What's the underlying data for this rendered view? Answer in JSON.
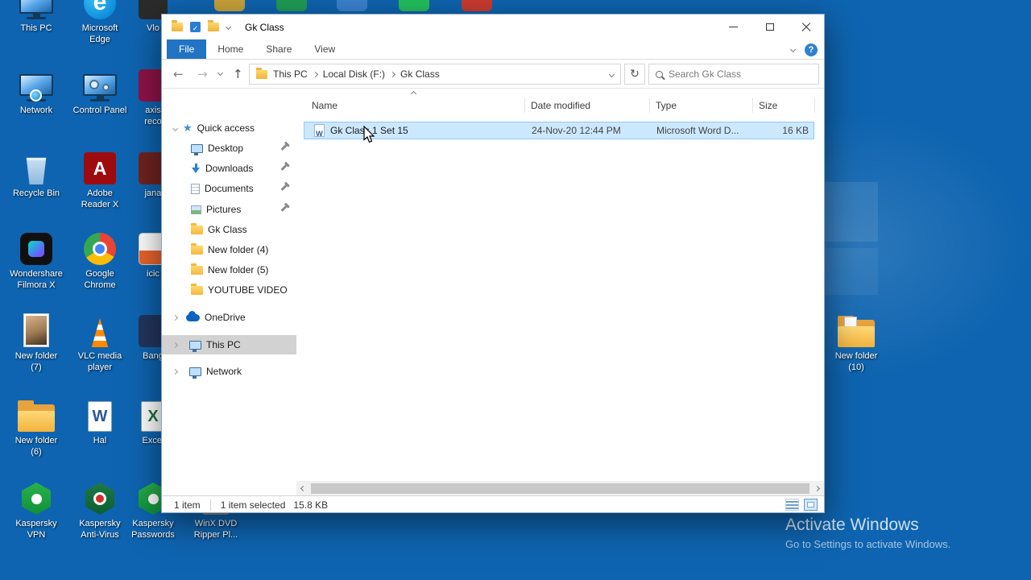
{
  "desktop": {
    "bg_color": "#0e64b0",
    "activate": {
      "line1": "Activate Windows",
      "line2": "Go to Settings to activate Windows."
    },
    "icons": [
      {
        "label": "This PC"
      },
      {
        "label": "Network"
      },
      {
        "label": "Recycle Bin"
      },
      {
        "label": "Wondershare Filmora X"
      },
      {
        "label": "New folder (7)"
      },
      {
        "label": "New folder (6)"
      },
      {
        "label": "Kaspersky VPN"
      },
      {
        "label": "Microsoft Edge"
      },
      {
        "label": "Control Panel"
      },
      {
        "label": "Adobe Reader X"
      },
      {
        "label": "Google Chrome"
      },
      {
        "label": "VLC media player"
      },
      {
        "label": "Hal"
      },
      {
        "label": "Kaspersky Anti-Virus"
      },
      {
        "label": "Vlo"
      },
      {
        "label": "axis reco"
      },
      {
        "label": "jana"
      },
      {
        "label": "icic"
      },
      {
        "label": "Bang"
      },
      {
        "label": "Excel"
      },
      {
        "label": "Kaspersky Passwords"
      },
      {
        "label": "WinX DVD Ripper Pl..."
      },
      {
        "label": "New folder (10)"
      }
    ]
  },
  "explorer": {
    "title": "Gk Class",
    "ribbon": {
      "file": "File",
      "home": "Home",
      "share": "Share",
      "view": "View"
    },
    "address": {
      "crumbs": [
        "This PC",
        "Local Disk (F:)",
        "Gk Class"
      ]
    },
    "search_placeholder": "Search Gk Class",
    "sidebar": {
      "quick_access_label": "Quick access",
      "pinned": [
        {
          "label": "Desktop"
        },
        {
          "label": "Downloads"
        },
        {
          "label": "Documents"
        },
        {
          "label": "Pictures"
        }
      ],
      "folders": [
        {
          "label": "Gk Class"
        },
        {
          "label": "New folder (4)"
        },
        {
          "label": "New folder (5)"
        },
        {
          "label": "YOUTUBE VIDEO"
        }
      ],
      "onedrive_label": "OneDrive",
      "this_pc_label": "This PC",
      "network_label": "Network"
    },
    "columns": {
      "name": "Name",
      "date": "Date modified",
      "type": "Type",
      "size": "Size"
    },
    "file": {
      "name": "Gk Class 1 Set 15",
      "date": "24-Nov-20 12:44 PM",
      "type": "Microsoft Word D...",
      "size": "16 KB"
    },
    "status": {
      "count": "1 item",
      "selected": "1 item selected",
      "size": "15.8 KB"
    }
  },
  "icons": {
    "quick-access": "star",
    "onedrive": "cloud",
    "search": "magnifier",
    "refresh": "circular-arrow",
    "back": "left-arrow",
    "forward": "right-arrow",
    "up": "up-arrow",
    "help": "question-circle",
    "pin": "pushpin",
    "file-word": "word-document-page",
    "sort-ascending": "chevron-up"
  }
}
